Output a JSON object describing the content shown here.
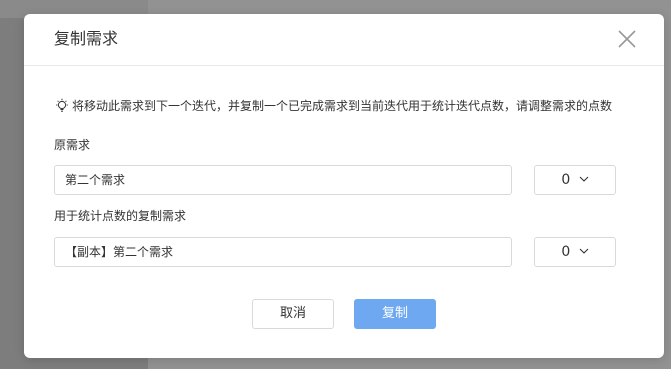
{
  "dialog": {
    "title": "复制需求",
    "hint": "将移动此需求到下一个迭代，并复制一个已完成需求到当前迭代用于统计迭代点数，请调整需求的点数",
    "original": {
      "label": "原需求",
      "value": "第二个需求",
      "points": "0"
    },
    "copy": {
      "label": "用于统计点数的复制需求",
      "value": "【副本】第二个需求",
      "points": "0"
    },
    "buttons": {
      "cancel": "取消",
      "confirm": "复制"
    }
  },
  "colors": {
    "primary": "#6ea8f0",
    "overlay": "#8f8f8f",
    "border": "#d9d9d9"
  },
  "icons": [
    "close-icon",
    "lightbulb-icon",
    "chevron-down-icon"
  ]
}
